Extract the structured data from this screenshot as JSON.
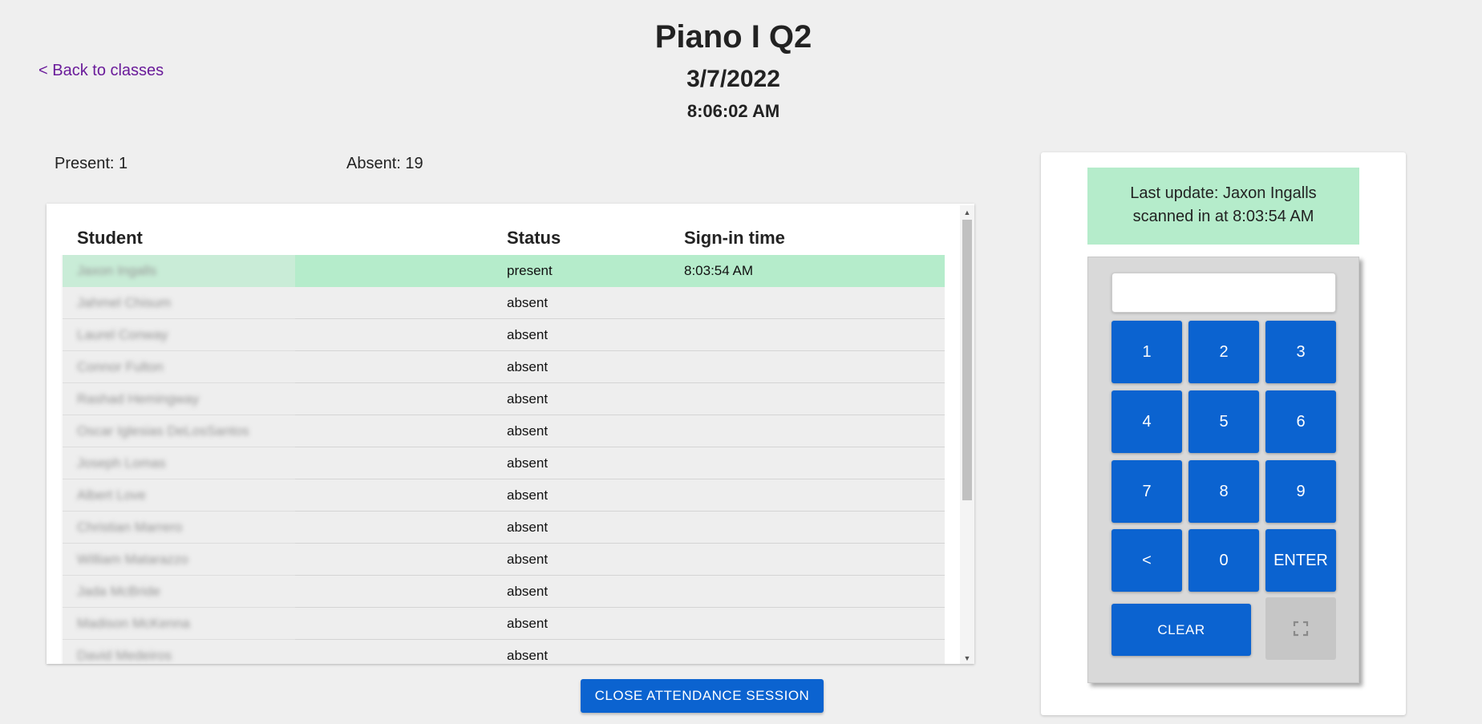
{
  "header": {
    "class_name": "Piano I Q2",
    "date": "3/7/2022",
    "time": "8:06:02 AM",
    "back_link": "< Back to classes"
  },
  "counts": {
    "present": "Present: 1",
    "absent": "Absent: 19"
  },
  "table": {
    "columns": [
      "Student",
      "Status",
      "Sign-in time"
    ],
    "rows": [
      {
        "name": "Jaxon Ingalls",
        "status": "present",
        "time": "8:03:54 AM"
      },
      {
        "name": "Jahmel Chisum",
        "status": "absent",
        "time": ""
      },
      {
        "name": "Laurel Conway",
        "status": "absent",
        "time": ""
      },
      {
        "name": "Connor Fulton",
        "status": "absent",
        "time": ""
      },
      {
        "name": "Rashad Hemingway",
        "status": "absent",
        "time": ""
      },
      {
        "name": "Oscar Iglesias DeLosSantos",
        "status": "absent",
        "time": ""
      },
      {
        "name": "Joseph Lomas",
        "status": "absent",
        "time": ""
      },
      {
        "name": "Albert Love",
        "status": "absent",
        "time": ""
      },
      {
        "name": "Christian Marrero",
        "status": "absent",
        "time": ""
      },
      {
        "name": "William Matarazzo",
        "status": "absent",
        "time": ""
      },
      {
        "name": "Jada McBride",
        "status": "absent",
        "time": ""
      },
      {
        "name": "Madison McKenna",
        "status": "absent",
        "time": ""
      },
      {
        "name": "David Medeiros",
        "status": "absent",
        "time": ""
      }
    ]
  },
  "close_button": "CLOSE ATTENDANCE SESSION",
  "last_update": {
    "line1": "Last update: Jaxon Ingalls",
    "line2": "scanned in at 8:03:54 AM"
  },
  "keypad": {
    "input_value": "",
    "keys": [
      "1",
      "2",
      "3",
      "4",
      "5",
      "6",
      "7",
      "8",
      "9",
      "<",
      "0",
      "ENTER"
    ],
    "clear": "CLEAR",
    "fullscreen_icon": "fullscreen-icon"
  },
  "colors": {
    "primary": "#0b63d0",
    "present_row": "#b5eccb",
    "link": "#6a1b9a",
    "background": "#efefef"
  }
}
